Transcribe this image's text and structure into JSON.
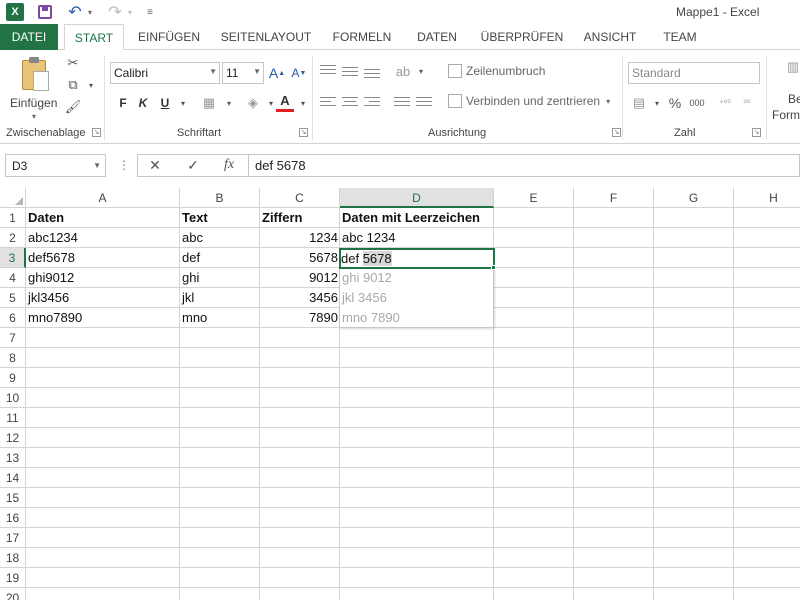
{
  "window": {
    "title": "Mappe1 - Excel",
    "app_logo": "X"
  },
  "ribbon_tabs": [
    "DATEI",
    "START",
    "EINFÜGEN",
    "SEITENLAYOUT",
    "FORMELN",
    "DATEN",
    "ÜBERPRÜFEN",
    "ANSICHT",
    "TEAM"
  ],
  "ribbon": {
    "clipboard": {
      "paste_label": "Einfügen",
      "group_label": "Zwischenablage"
    },
    "font": {
      "font_name": "Calibri",
      "font_size": "11",
      "bold": "F",
      "italic": "K",
      "underline": "U",
      "group_label": "Schriftart"
    },
    "alignment": {
      "wrap_label": "Zeilenumbruch",
      "merge_label": "Verbinden und zentrieren",
      "group_label": "Ausrichtung"
    },
    "number": {
      "format_value": "Standard",
      "percent": "%",
      "thousands": "000",
      "group_label": "Zahl"
    },
    "styles_partial": {
      "line1": "Be",
      "line2": "Forma"
    }
  },
  "formula_bar": {
    "name_box": "D3",
    "fx_label": "fx",
    "content": "def 5678"
  },
  "sheet": {
    "columns": [
      "A",
      "B",
      "C",
      "D",
      "E",
      "F",
      "G",
      "H"
    ],
    "selected_column": "D",
    "rows": [
      "1",
      "2",
      "3",
      "4",
      "5",
      "6",
      "7",
      "8",
      "9",
      "10",
      "11",
      "12",
      "13",
      "14",
      "15",
      "16",
      "17",
      "18",
      "19",
      "20"
    ],
    "selected_row": "3",
    "header": [
      "Daten",
      "Text",
      "Ziffern",
      "Daten mit Leerzeichen"
    ],
    "data": [
      [
        "abc1234",
        "abc",
        "1234",
        "abc 1234"
      ],
      [
        "def5678",
        "def",
        "5678",
        ""
      ],
      [
        "ghi9012",
        "ghi",
        "9012",
        ""
      ],
      [
        "jkl3456",
        "jkl",
        "3456",
        ""
      ],
      [
        "mno7890",
        "mno",
        "7890",
        ""
      ]
    ],
    "active_cell": {
      "text_part1": "def ",
      "text_part2": "5678"
    },
    "flash_fill_preview": [
      "ghi 9012",
      "jkl 3456",
      "mno 7890"
    ]
  },
  "colors": {
    "accent": "#217346",
    "ghost_text": "#a9a9a9",
    "gridline": "#d4d4d4"
  }
}
